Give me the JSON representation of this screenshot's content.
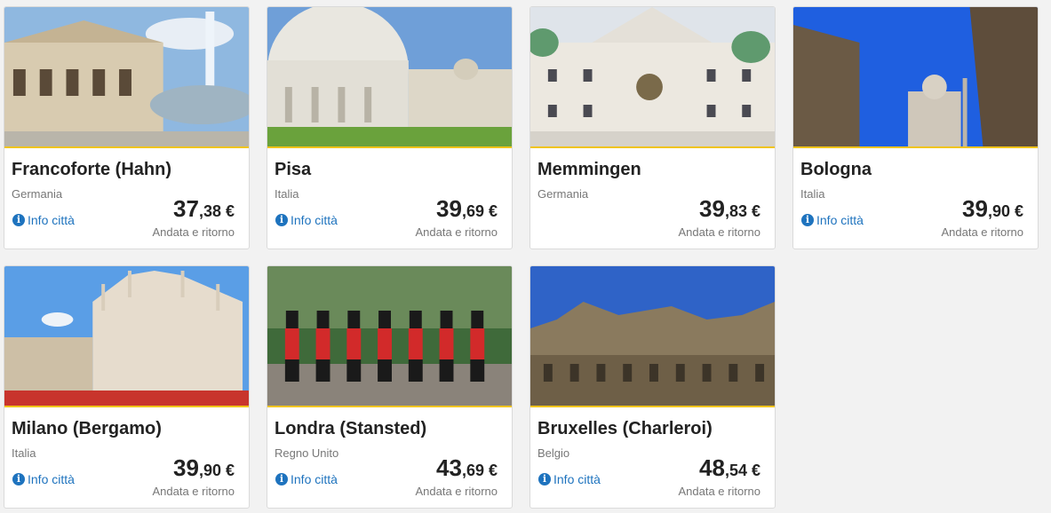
{
  "info_label": "Info città",
  "cards": [
    {
      "city": "Francoforte (Hahn)",
      "country": "Germania",
      "price_int": "37",
      "price_dec": ",38",
      "currency": " €",
      "trip": "Andata e ritorno",
      "show_info": true
    },
    {
      "city": "Pisa",
      "country": "Italia",
      "price_int": "39",
      "price_dec": ",69",
      "currency": " €",
      "trip": "Andata e ritorno",
      "show_info": true
    },
    {
      "city": "Memmingen",
      "country": "Germania",
      "price_int": "39",
      "price_dec": ",83",
      "currency": " €",
      "trip": "Andata e ritorno",
      "show_info": false
    },
    {
      "city": "Bologna",
      "country": "Italia",
      "price_int": "39",
      "price_dec": ",90",
      "currency": " €",
      "trip": "Andata e ritorno",
      "show_info": true
    },
    {
      "city": "Milano (Bergamo)",
      "country": "Italia",
      "price_int": "39",
      "price_dec": ",90",
      "currency": " €",
      "trip": "Andata e ritorno",
      "show_info": true
    },
    {
      "city": "Londra (Stansted)",
      "country": "Regno Unito",
      "price_int": "43",
      "price_dec": ",69",
      "currency": " €",
      "trip": "Andata e ritorno",
      "show_info": true
    },
    {
      "city": "Bruxelles (Charleroi)",
      "country": "Belgio",
      "price_int": "48",
      "price_dec": ",54",
      "currency": " €",
      "trip": "Andata e ritorno",
      "show_info": true
    }
  ],
  "colors": {
    "accent_line": "#f0c419",
    "link": "#1e73be"
  }
}
